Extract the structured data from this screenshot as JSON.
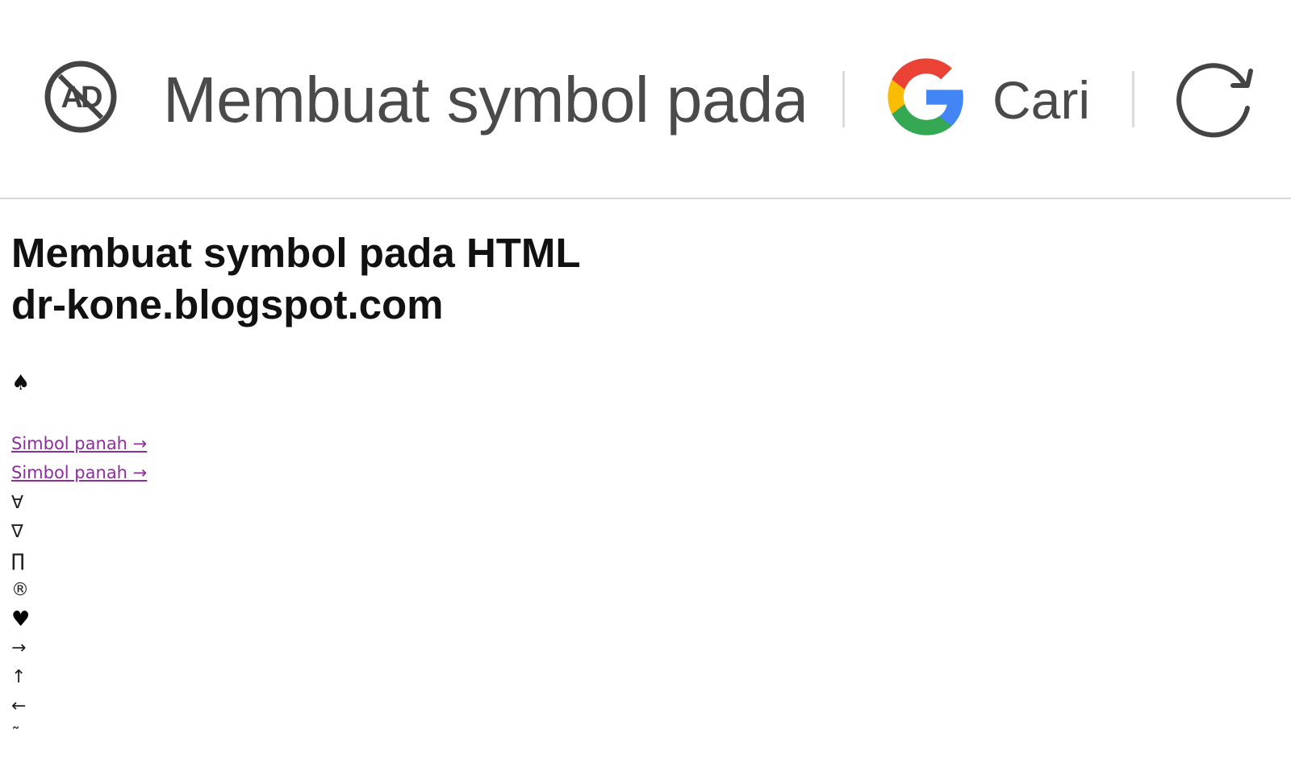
{
  "toolbar": {
    "title": "Membuat symbol pada HTML",
    "search_label": "Cari",
    "adblock_icon_text": "AD"
  },
  "page": {
    "heading_line1": "Membuat symbol pada HTML",
    "heading_line2": "dr-kone.blogspot.com",
    "spade_symbol": "♠",
    "links": [
      "Simbol panah →",
      "Simbol panah →"
    ],
    "symbols": [
      "∀",
      "∇",
      "∏",
      "®",
      "♥",
      "→",
      "↑",
      "←",
      "˜"
    ]
  },
  "colors": {
    "link": "#8b2f9a",
    "title_text": "#4a4a4a",
    "divider": "#d9d9d9",
    "google_blue": "#4285F4",
    "google_red": "#EA4335",
    "google_yellow": "#FBBC05",
    "google_green": "#34A853"
  },
  "icons": {
    "adblock": "ad-block-icon",
    "google": "google-logo-icon",
    "reload": "reload-icon"
  }
}
